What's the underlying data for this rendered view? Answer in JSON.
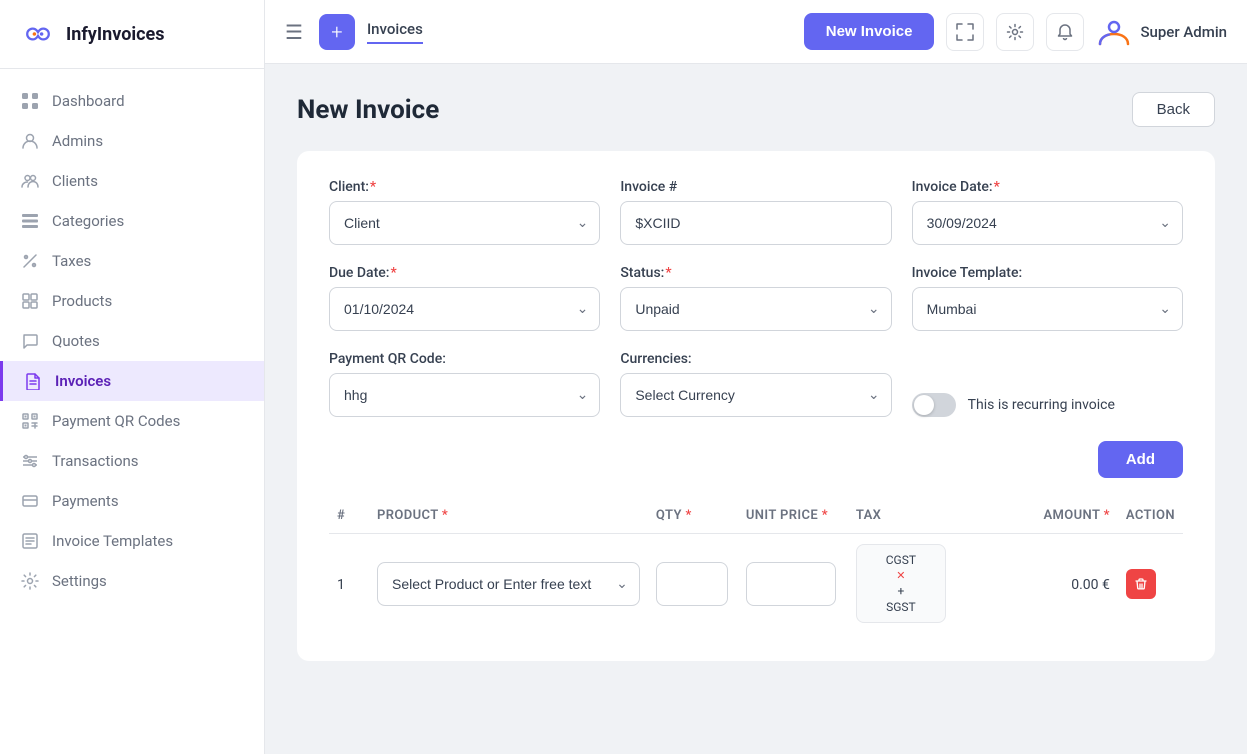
{
  "app": {
    "name": "InfyInvoices"
  },
  "topbar": {
    "tab_label": "Invoices",
    "new_invoice_btn": "New Invoice",
    "user_name": "Super Admin"
  },
  "sidebar": {
    "items": [
      {
        "id": "dashboard",
        "label": "Dashboard",
        "icon": "🏠"
      },
      {
        "id": "admins",
        "label": "Admins",
        "icon": "👤"
      },
      {
        "id": "clients",
        "label": "Clients",
        "icon": "👥"
      },
      {
        "id": "categories",
        "label": "Categories",
        "icon": "🗂"
      },
      {
        "id": "taxes",
        "label": "Taxes",
        "icon": "✂"
      },
      {
        "id": "products",
        "label": "Products",
        "icon": "🗃"
      },
      {
        "id": "quotes",
        "label": "Quotes",
        "icon": "💬"
      },
      {
        "id": "invoices",
        "label": "Invoices",
        "icon": "📄",
        "active": true
      },
      {
        "id": "payment-qr-codes",
        "label": "Payment QR Codes",
        "icon": "⊞"
      },
      {
        "id": "transactions",
        "label": "Transactions",
        "icon": "≡"
      },
      {
        "id": "payments",
        "label": "Payments",
        "icon": "💳"
      },
      {
        "id": "invoice-templates",
        "label": "Invoice Templates",
        "icon": "📋"
      },
      {
        "id": "settings",
        "label": "Settings",
        "icon": "⚙"
      }
    ]
  },
  "page": {
    "title": "New Invoice",
    "back_btn": "Back"
  },
  "form": {
    "client_label": "Client:",
    "client_placeholder": "Client",
    "invoice_num_label": "Invoice #",
    "invoice_num_value": "$XCIID",
    "invoice_date_label": "Invoice Date:",
    "invoice_date_value": "30/09/2024",
    "due_date_label": "Due Date:",
    "due_date_value": "01/10/2024",
    "status_label": "Status:",
    "status_value": "Unpaid",
    "invoice_template_label": "Invoice Template:",
    "invoice_template_value": "Mumbai",
    "payment_qr_label": "Payment QR Code:",
    "payment_qr_value": "hhg",
    "currencies_label": "Currencies:",
    "currencies_placeholder": "Select Currency",
    "recurring_label": "This is recurring invoice",
    "add_btn": "Add",
    "table": {
      "col_hash": "#",
      "col_product": "PRODUCT",
      "col_qty": "QTY",
      "col_unit_price": "UNIT PRICE",
      "col_tax": "TAX",
      "col_amount": "AMOUNT",
      "col_action": "ACTION",
      "rows": [
        {
          "num": "1",
          "product_placeholder": "Select Product or Enter free text",
          "qty": "",
          "unit_price": "",
          "tax_line1": "CGST",
          "tax_line2": "✕",
          "tax_line3": "+",
          "tax_line4": "SGST",
          "amount": "0.00 €"
        }
      ]
    }
  }
}
